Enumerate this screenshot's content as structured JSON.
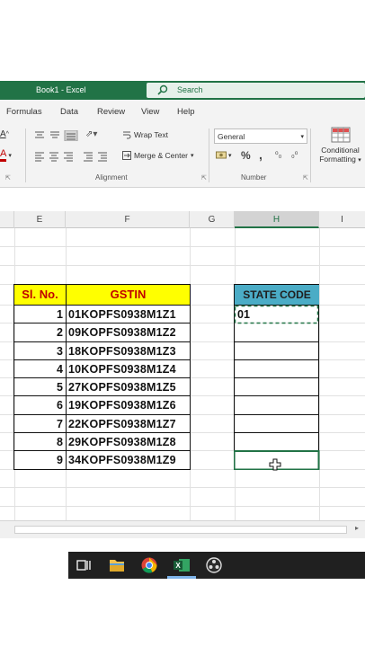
{
  "window": {
    "title": "Book1  -  Excel"
  },
  "search": {
    "placeholder": "Search"
  },
  "tabs": [
    "Formulas",
    "Data",
    "Review",
    "View",
    "Help"
  ],
  "ribbon": {
    "wrap_text": "Wrap Text",
    "merge_center": "Merge & Center",
    "alignment_label": "Alignment",
    "number_format": "General",
    "number_label": "Number",
    "conditional_line1": "Conditional",
    "conditional_line2": "Formatting",
    "percent": "%",
    "comma": ",",
    "dec_inc": "⁰₀",
    "dec_dec": "₀⁰"
  },
  "columns": [
    "E",
    "F",
    "G",
    "H",
    "I"
  ],
  "table": {
    "header_slno": "Sl. No.",
    "header_gstin": "GSTIN",
    "header_state": "STATE CODE",
    "rows": [
      {
        "sl": "1",
        "gstin": "01KOPFS0938M1Z1",
        "state": "01"
      },
      {
        "sl": "2",
        "gstin": "09KOPFS0938M1Z2",
        "state": ""
      },
      {
        "sl": "3",
        "gstin": "18KOPFS0938M1Z3",
        "state": ""
      },
      {
        "sl": "4",
        "gstin": "10KOPFS0938M1Z4",
        "state": ""
      },
      {
        "sl": "5",
        "gstin": "27KOPFS0938M1Z5",
        "state": ""
      },
      {
        "sl": "6",
        "gstin": "19KOPFS0938M1Z6",
        "state": ""
      },
      {
        "sl": "7",
        "gstin": "22KOPFS0938M1Z7",
        "state": ""
      },
      {
        "sl": "8",
        "gstin": "29KOPFS0938M1Z8",
        "state": ""
      },
      {
        "sl": "9",
        "gstin": "34KOPFS0938M1Z9",
        "state": ""
      }
    ]
  },
  "colors": {
    "excel_green": "#217346",
    "header_yellow": "#ffff00",
    "header_red_text": "#c00000",
    "header_blue": "#4bacc6"
  },
  "icons": [
    "search-icon",
    "task-view-icon",
    "file-explorer-icon",
    "chrome-icon",
    "excel-icon",
    "obs-icon"
  ]
}
